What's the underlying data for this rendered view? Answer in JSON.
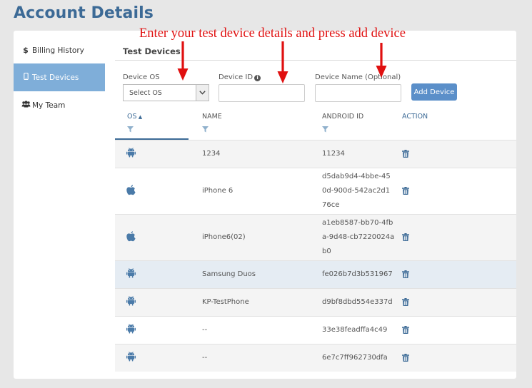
{
  "page": {
    "title": "Account Details"
  },
  "sidebar": {
    "items": [
      {
        "label": "Billing History",
        "icon": "dollar-icon",
        "active": false
      },
      {
        "label": "Test Devices",
        "icon": "mobile-icon",
        "active": true
      },
      {
        "label": "My Team",
        "icon": "users-icon",
        "active": false
      }
    ]
  },
  "main": {
    "section_title": "Test Devices",
    "form": {
      "os_label": "Device OS",
      "os_value": "Select OS",
      "id_label": "Device ID",
      "id_value": "",
      "name_label": "Device Name (Optional)",
      "name_value": "",
      "add_label": "Add Device"
    },
    "table": {
      "headers": {
        "os": "OS",
        "name": "NAME",
        "android_id": "ANDROID ID",
        "action": "ACTION"
      },
      "rows": [
        {
          "os": "android",
          "name": "1234",
          "id_lines": [
            "11234"
          ]
        },
        {
          "os": "apple",
          "name": "iPhone 6",
          "id_lines": [
            "d5dab9d4-4bbe-45",
            "0d-900d-542ac2d1",
            "76ce"
          ]
        },
        {
          "os": "apple",
          "name": "iPhone6(02)",
          "id_lines": [
            "a1eb8587-bb70-4fb",
            "a-9d48-cb7220024a",
            "b0"
          ]
        },
        {
          "os": "android",
          "name": "Samsung Duos",
          "id_lines": [
            "fe026b7d3b531967"
          ]
        },
        {
          "os": "android",
          "name": "KP-TestPhone",
          "id_lines": [
            "d9bf8dbd554e337d"
          ]
        },
        {
          "os": "android",
          "name": "--",
          "id_lines": [
            "33e38feadffa4c49"
          ]
        },
        {
          "os": "android",
          "name": "--",
          "id_lines": [
            "6e7c7ff962730dfa"
          ]
        }
      ]
    }
  },
  "annotation": {
    "text": "Enter your test device details and press add device"
  },
  "colors": {
    "accent": "#3c6a96",
    "active_bg": "#7faed9",
    "button": "#5b8fc9",
    "annotation": "#e01010"
  }
}
